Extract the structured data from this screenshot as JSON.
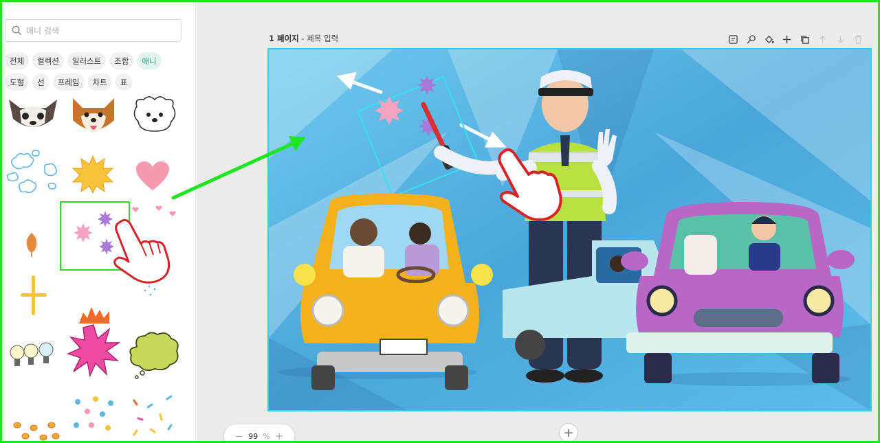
{
  "sidebar": {
    "search": {
      "placeholder": "애니 검색"
    },
    "categories_row1": [
      "전체",
      "컬렉션",
      "일러스트",
      "조합",
      "애니"
    ],
    "categories_row2": [
      "도형",
      "선",
      "프레임",
      "차트",
      "표"
    ],
    "active_category": "애니"
  },
  "workspace": {
    "page_number": "1 페이지",
    "page_title_placeholder": "- 제목 입력",
    "zoom": {
      "minus": "−",
      "value": "99",
      "unit": "%",
      "plus": "+"
    },
    "add_page": "+"
  },
  "colors": {
    "accent": "#1f9f79",
    "selection": "#36d0e6",
    "highlight": "#1ee61e"
  }
}
